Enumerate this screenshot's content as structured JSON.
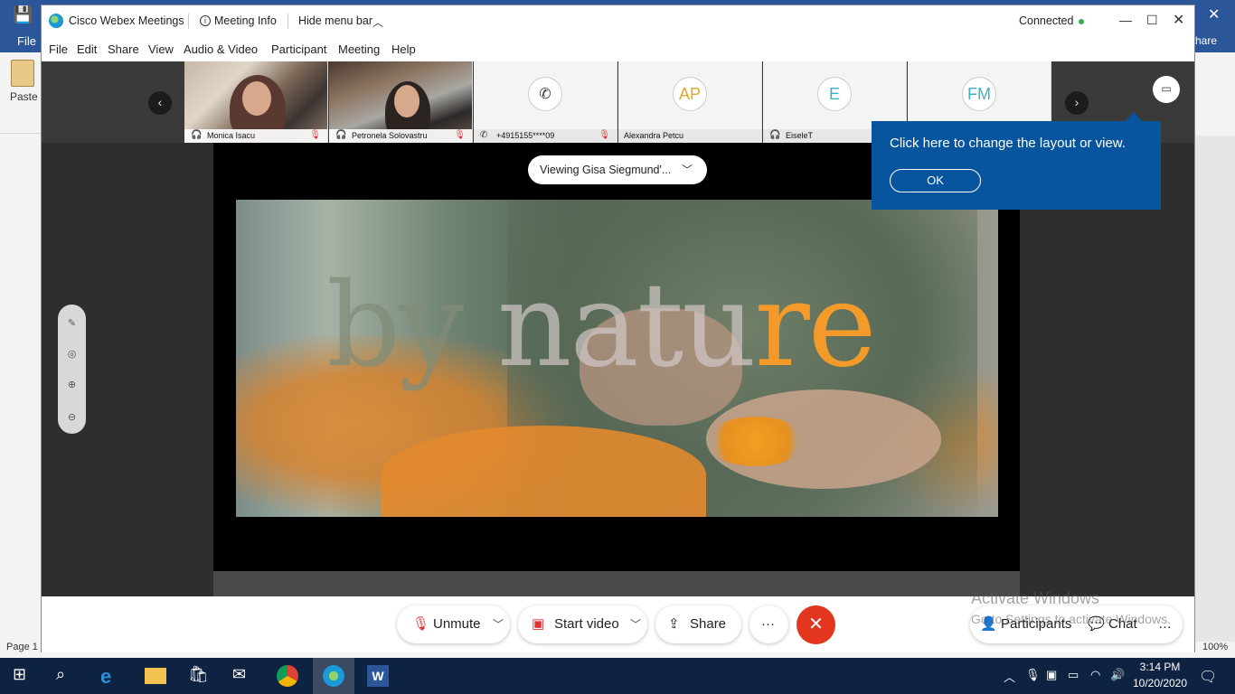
{
  "window": {
    "title": "Cisco Webex Meetings",
    "meeting_info": "Meeting Info",
    "hide_menu_bar": "Hide menu bar",
    "status": "Connected"
  },
  "menu": [
    "File",
    "Edit",
    "Share",
    "View",
    "Audio & Video",
    "Participant",
    "Meeting",
    "Help"
  ],
  "participants": [
    {
      "name": "Monica Isacu",
      "type": "video"
    },
    {
      "name": "Petronela Solovastru",
      "type": "video"
    },
    {
      "name": "+4915155****09",
      "type": "phone"
    },
    {
      "name": "Alexandra Petcu",
      "initials": "AP",
      "type": "avatar",
      "initials_color": "#e7a528"
    },
    {
      "name": "EiseleT",
      "initials": "E",
      "type": "avatar",
      "initials_color": "#3cb3c5"
    },
    {
      "name": "",
      "initials": "FM",
      "type": "avatar",
      "initials_color": "#3cb3c5"
    }
  ],
  "viewing": "Viewing Gisa Siegmund'...",
  "shared_content": {
    "overlay_text_1": "by ",
    "overlay_text_2": "natu",
    "overlay_text_3": "re"
  },
  "tooltip": {
    "text": "Click here to change the layout or view.",
    "ok": "OK"
  },
  "controls": {
    "unmute": "Unmute",
    "start_video": "Start video",
    "share": "Share",
    "more": "···",
    "participants": "Participants",
    "chat": "Chat"
  },
  "watermark": {
    "line1": "Activate Windows",
    "line2": "Go to Settings to activate Windows."
  },
  "word": {
    "file": "File",
    "share": "hare",
    "paste": "Paste",
    "page": "Page 1",
    "zoom": "100%"
  },
  "taskbar": {
    "time": "3:14 PM",
    "date": "10/20/2020"
  },
  "colors": {
    "accent": "#07559e",
    "end_call": "#e3361e",
    "connected": "#2fb24c",
    "muted": "#d33333"
  }
}
